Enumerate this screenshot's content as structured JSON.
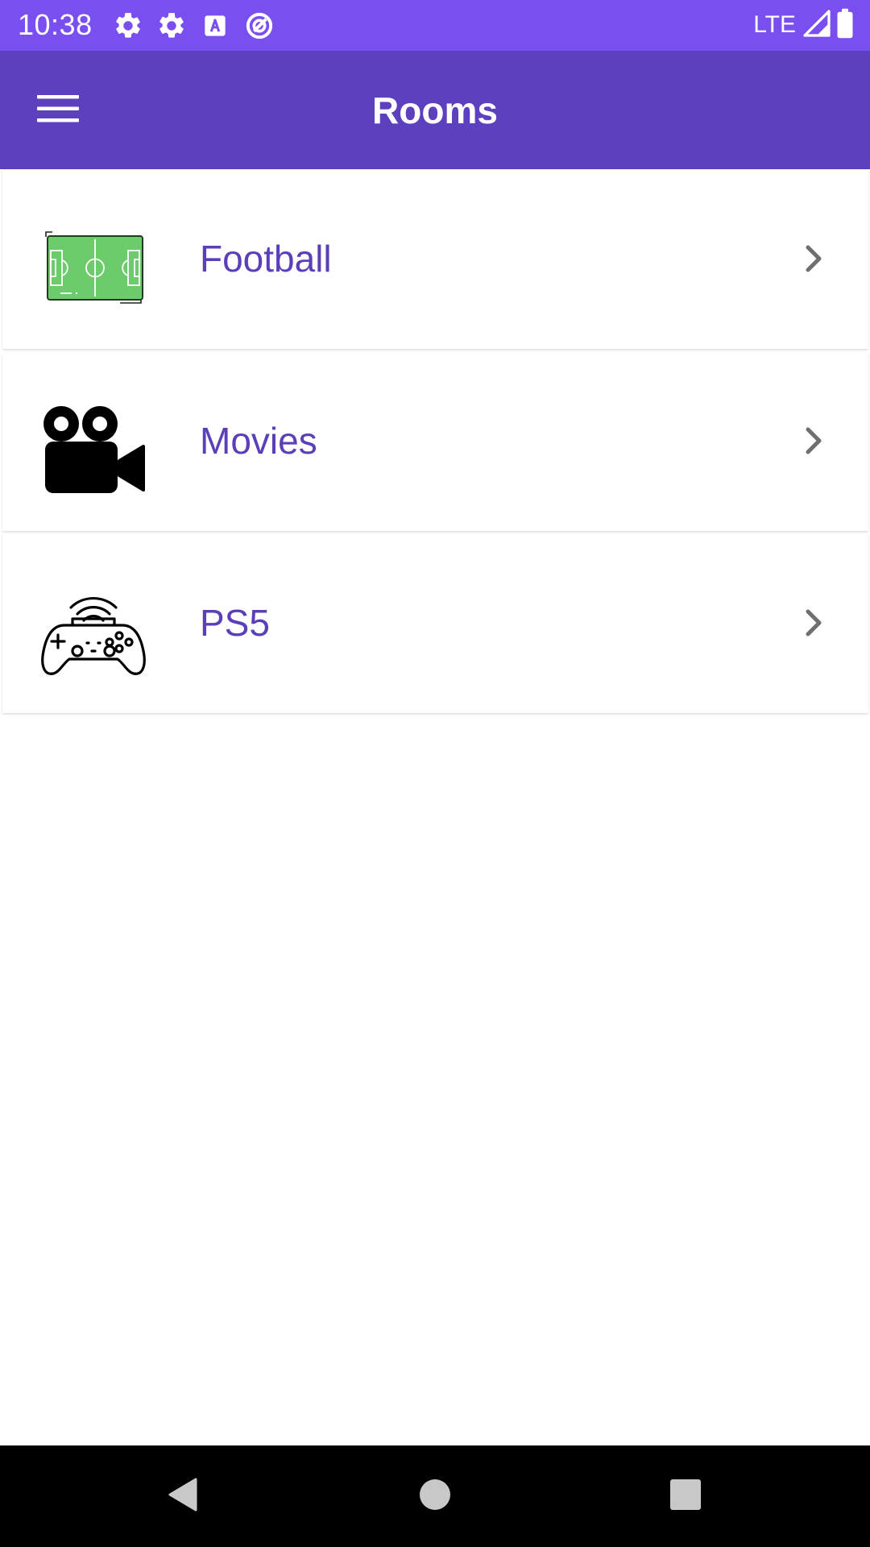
{
  "status_bar": {
    "time": "10:38",
    "network_label": "LTE",
    "icons": [
      "settings-icon",
      "settings-icon",
      "text-recognition-icon",
      "data-saver-icon",
      "signal-icon",
      "battery-icon"
    ]
  },
  "app_bar": {
    "title": "Rooms",
    "menu_icon": "hamburger-menu-icon"
  },
  "rooms": [
    {
      "label": "Football",
      "icon": "football-field-icon"
    },
    {
      "label": "Movies",
      "icon": "movie-camera-icon"
    },
    {
      "label": "PS5",
      "icon": "gamepad-icon"
    }
  ],
  "nav_bar": {
    "buttons": [
      "back",
      "home",
      "recents"
    ]
  },
  "colors": {
    "status_bar": "#7a4ff0",
    "app_bar": "#5d40bd",
    "room_label": "#5b3fb8",
    "chevron": "#6f6f6f",
    "nav_bar": "#000000"
  }
}
